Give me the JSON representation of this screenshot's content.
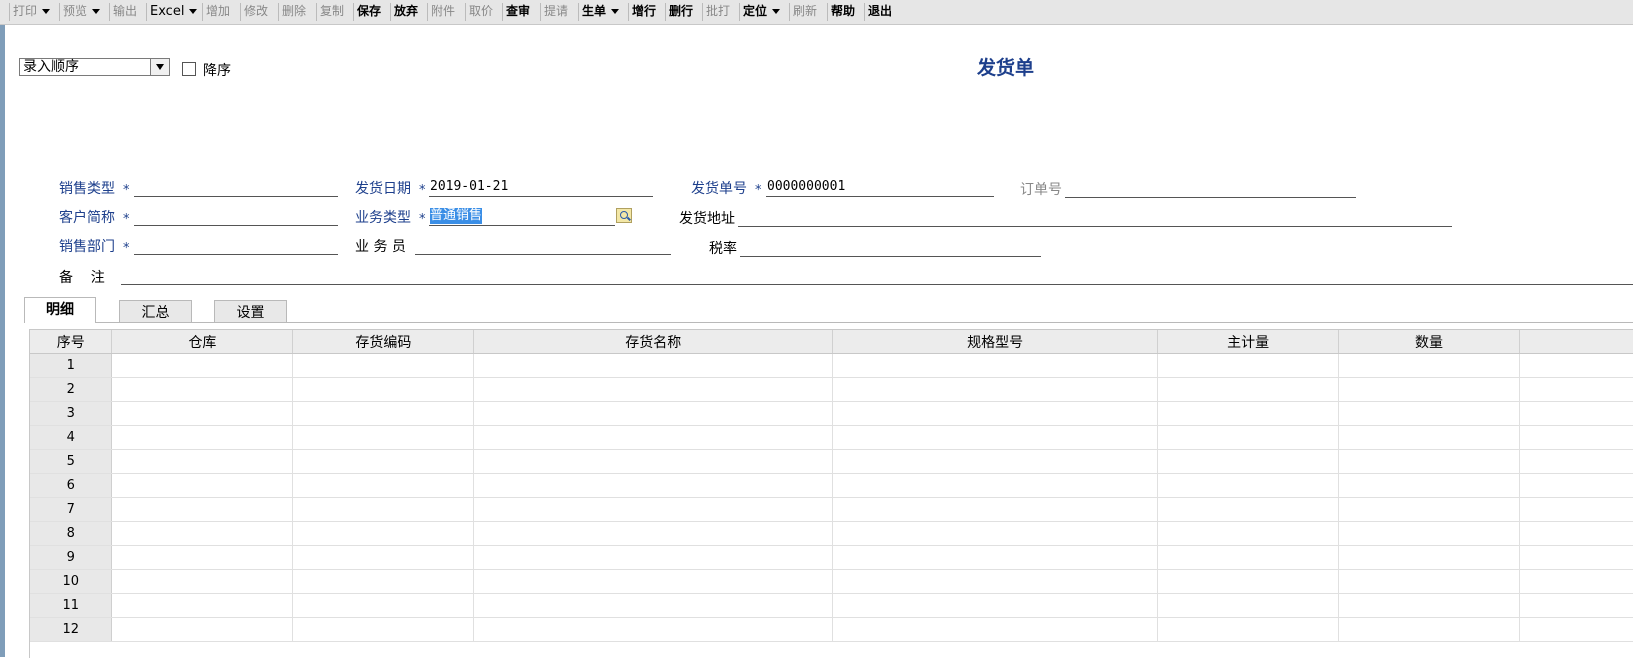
{
  "toolbar": {
    "buttons": [
      {
        "label": "打印",
        "enabled": false,
        "dropdown": true
      },
      {
        "label": "预览",
        "enabled": false,
        "dropdown": true
      },
      {
        "label": "输出",
        "enabled": false,
        "dropdown": false
      },
      {
        "label": "Excel",
        "enabled": true,
        "dropdown": true
      },
      {
        "label": "增加",
        "enabled": false,
        "dropdown": false
      },
      {
        "label": "修改",
        "enabled": false,
        "dropdown": false
      },
      {
        "label": "删除",
        "enabled": false,
        "dropdown": false
      },
      {
        "label": "复制",
        "enabled": false,
        "dropdown": false
      },
      {
        "label": "保存",
        "enabled": true,
        "dropdown": false
      },
      {
        "label": "放弃",
        "enabled": true,
        "dropdown": false
      },
      {
        "label": "附件",
        "enabled": false,
        "dropdown": false
      },
      {
        "label": "取价",
        "enabled": false,
        "dropdown": false
      },
      {
        "label": "查审",
        "enabled": true,
        "dropdown": false
      },
      {
        "label": "提请",
        "enabled": false,
        "dropdown": false
      },
      {
        "label": "生单",
        "enabled": true,
        "dropdown": true
      },
      {
        "label": "增行",
        "enabled": true,
        "dropdown": false
      },
      {
        "label": "删行",
        "enabled": true,
        "dropdown": false
      },
      {
        "label": "批打",
        "enabled": false,
        "dropdown": false
      },
      {
        "label": "定位",
        "enabled": true,
        "dropdown": true
      },
      {
        "label": "刷新",
        "enabled": false,
        "dropdown": false
      },
      {
        "label": "帮助",
        "enabled": true,
        "dropdown": false
      },
      {
        "label": "退出",
        "enabled": true,
        "dropdown": false
      }
    ]
  },
  "sort": {
    "selected": "录入顺序",
    "desc_label": "降序",
    "desc_checked": false
  },
  "title": "发货单",
  "fields": {
    "sales_type": {
      "label": "销售类型",
      "required": true,
      "value": ""
    },
    "ship_date": {
      "label": "发货日期",
      "required": true,
      "value": "2019-01-21"
    },
    "ship_no": {
      "label": "发货单号",
      "required": true,
      "value": "0000000001"
    },
    "order_no": {
      "label": "订单号",
      "required": false,
      "value": ""
    },
    "customer": {
      "label": "客户简称",
      "required": true,
      "value": ""
    },
    "biz_type": {
      "label": "业务类型",
      "required": true,
      "value": "普通销售"
    },
    "ship_addr": {
      "label": "发货地址",
      "required": false,
      "value": ""
    },
    "sales_dept": {
      "label": "销售部门",
      "required": true,
      "value": ""
    },
    "clerk": {
      "label": "业 务 员",
      "required": false,
      "value": ""
    },
    "tax_rate": {
      "label": "税率",
      "required": false,
      "value": ""
    },
    "remark": {
      "label": "备    注",
      "required": false,
      "value": ""
    }
  },
  "required_mark": "*",
  "tabs": [
    "明细",
    "汇总",
    "设置"
  ],
  "grid": {
    "columns": [
      "序号",
      "仓库",
      "存货编码",
      "存货名称",
      "规格型号",
      "主计量",
      "数量"
    ],
    "rows": [
      "1",
      "2",
      "3",
      "4",
      "5",
      "6",
      "7",
      "8",
      "9",
      "10",
      "11",
      "12"
    ]
  }
}
